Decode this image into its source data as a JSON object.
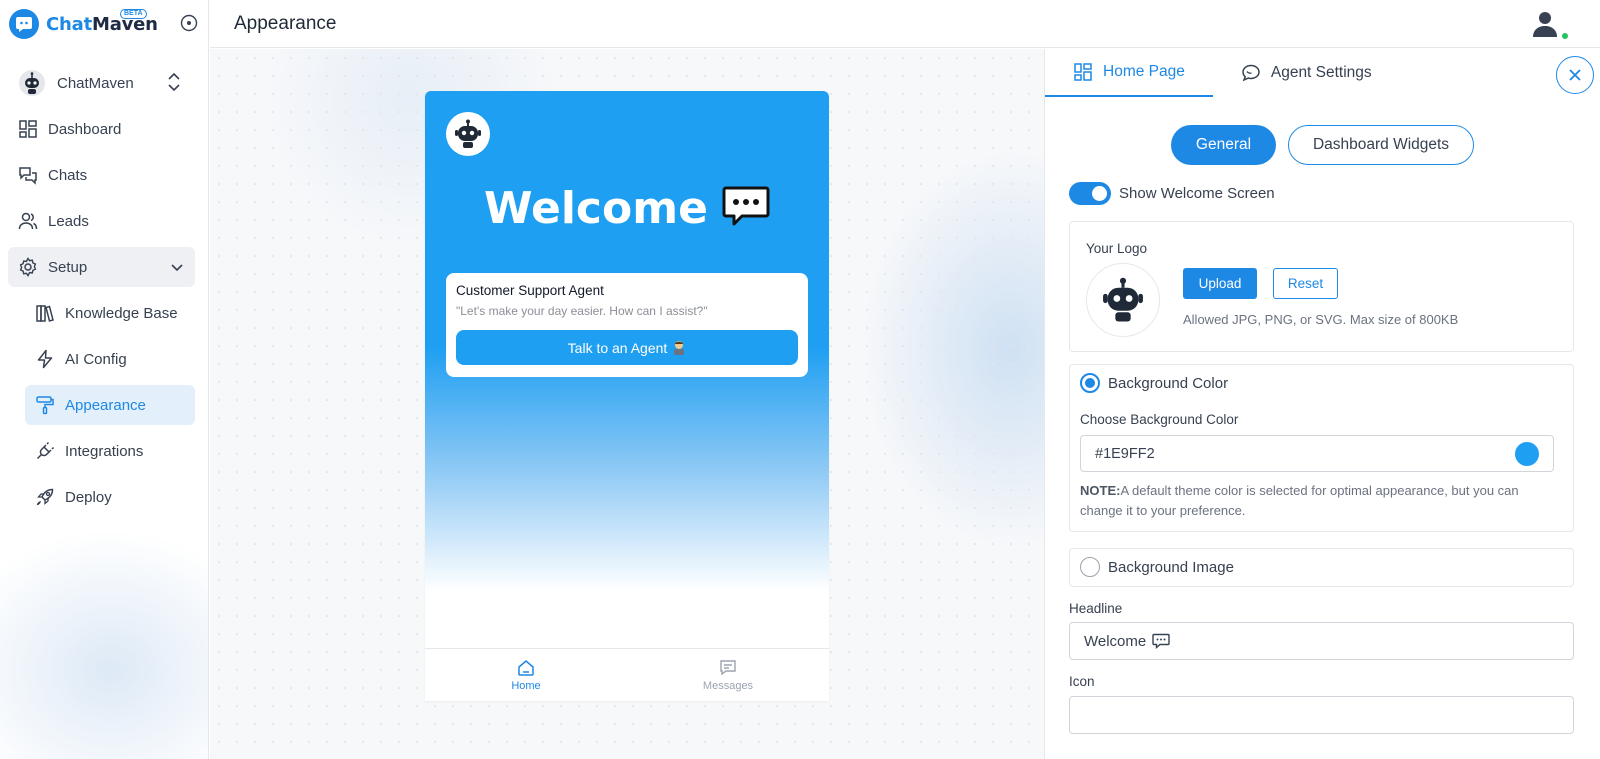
{
  "brand": {
    "name_part1": "Chat",
    "name_part2": "Maven",
    "badge": "BETA"
  },
  "workspace": {
    "name": "ChatMaven"
  },
  "sidebar": {
    "items": [
      {
        "label": "Dashboard",
        "icon": "dashboard-icon"
      },
      {
        "label": "Chats",
        "icon": "chats-icon"
      },
      {
        "label": "Leads",
        "icon": "leads-icon"
      },
      {
        "label": "Setup",
        "icon": "gear-icon"
      }
    ],
    "sub_items": [
      {
        "label": "Knowledge Base",
        "icon": "books-icon"
      },
      {
        "label": "AI Config",
        "icon": "bolt-icon"
      },
      {
        "label": "Appearance",
        "icon": "paint-roller-icon"
      },
      {
        "label": "Integrations",
        "icon": "plug-icon"
      },
      {
        "label": "Deploy",
        "icon": "rocket-icon"
      }
    ]
  },
  "header": {
    "title": "Appearance"
  },
  "preview": {
    "headline": "Welcome",
    "card_title": "Customer Support Agent",
    "card_subtitle": "\"Let's make your day easier. How can I assist?\"",
    "card_button": "Talk to an Agent",
    "nav_home": "Home",
    "nav_messages": "Messages",
    "theme_color": "#1E9FF2"
  },
  "panel": {
    "tab_home": "Home Page",
    "tab_agent": "Agent Settings",
    "seg_general": "General",
    "seg_widgets": "Dashboard Widgets",
    "toggle_label": "Show Welcome Screen",
    "logo_title": "Your Logo",
    "upload_label": "Upload",
    "reset_label": "Reset",
    "logo_note": "Allowed JPG, PNG, or SVG. Max size of 800KB",
    "bg_color_label": "Background Color",
    "choose_bg_label": "Choose Background Color",
    "bg_color_value": "#1E9FF2",
    "note_bold": "NOTE:",
    "note_text": "A default theme color is selected for optimal appearance, but you can change it to your preference.",
    "bg_image_label": "Background Image",
    "headline_label": "Headline",
    "headline_value": "Welcome",
    "icon_label": "Icon",
    "icon_value": ""
  }
}
